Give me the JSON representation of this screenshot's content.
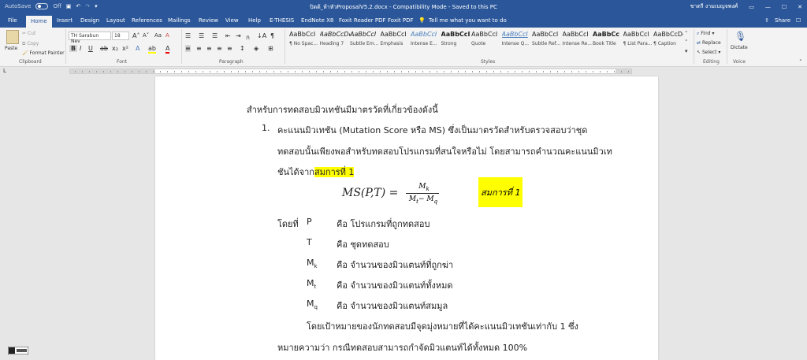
{
  "titlebar": {
    "autosave": "AutoSave",
    "autosave_state": "Off",
    "title": "ปิดต้_ห้าหัวProposalV5.2.docx  -  Compatibility Mode  -  Saved to this PC",
    "user": "ชาตรี งามเบญจพงศ์"
  },
  "tabs": [
    "File",
    "Home",
    "Insert",
    "Design",
    "Layout",
    "References",
    "Mailings",
    "Review",
    "View",
    "Help",
    "E-THESIS",
    "EndNote X8",
    "Foxit Reader PDF",
    "Foxit PDF"
  ],
  "tell_me": "Tell me what you want to do",
  "share": "Share",
  "clipboard": {
    "paste": "Paste",
    "cut": "Cut",
    "copy": "Copy",
    "format_painter": "Format Painter",
    "label": "Clipboard"
  },
  "font": {
    "name": "TH Sarabun Nev",
    "size": "18",
    "label": "Font"
  },
  "paragraph": {
    "label": "Paragraph"
  },
  "styles": {
    "label": "Styles",
    "items": [
      {
        "preview": "AaBbCcI",
        "name": "¶ No Spac..."
      },
      {
        "preview": "AaBbCcDc",
        "name": "Heading 7"
      },
      {
        "preview": "AaBbCcI",
        "name": "Subtle Em..."
      },
      {
        "preview": "AaBbCcI",
        "name": "Emphasis"
      },
      {
        "preview": "AaBbCcI",
        "name": "Intense E..."
      },
      {
        "preview": "AaBbCcI",
        "name": "Strong"
      },
      {
        "preview": "AaBbCcI",
        "name": "Quote"
      },
      {
        "preview": "AaBbCcI",
        "name": "Intense Q..."
      },
      {
        "preview": "AaBbCcI",
        "name": "Subtle Ref..."
      },
      {
        "preview": "AaBbCcI",
        "name": "Intense Re..."
      },
      {
        "preview": "AaBbCc",
        "name": "Book Title"
      },
      {
        "preview": "AaBbCcI",
        "name": "¶ List Para..."
      },
      {
        "preview": "AaBbCcDc",
        "name": "¶ Caption"
      }
    ]
  },
  "editing": {
    "find": "Find",
    "replace": "Replace",
    "select": "Select",
    "label": "Editing"
  },
  "voice": {
    "dictate": "Dictate",
    "label": "Voice"
  },
  "document": {
    "heading": "สำหรับการทดสอบมิวเทชันมีมาตรวัดที่เกี่ยวข้องดังนี้",
    "item_number": "1.",
    "item_line1": "คะแนนมิวเทชัน (Mutation Score หรือ MS) ซึ่งเป็นมาตรวัดสำหรับตรวจสอบว่าชุด",
    "item_line2": "ทดสอบนั้นเพียงพอสำหรับทดสอบโปรแกรมที่สนใจหรือไม่ โดยสามารถคำนวณคะแนนมิวเท",
    "item_line3_pre": "ชันได้จาก",
    "item_line3_hl": "สมการที่ 1",
    "equation": {
      "lhs": "MS(P,T)  =",
      "num": "M",
      "num_sub": "k",
      "den": "M",
      "den_sub1": "t",
      "den_mid": "− M",
      "den_sub2": "q",
      "tag": "สมการที่ 1"
    },
    "where": "โดยที่",
    "defs": [
      {
        "sym": "P",
        "sub": "",
        "desc": "คือ โปรแกรมที่ถูกทดสอบ"
      },
      {
        "sym": "T",
        "sub": "",
        "desc": "คือ ชุดทดสอบ"
      },
      {
        "sym": "M",
        "sub": "k",
        "desc": "คือ จำนวนของมิวแตนท์ที่ถูกฆ่า"
      },
      {
        "sym": "M",
        "sub": "t",
        "desc": "คือ จำนวนของมิวแตนท์ทั้งหมด"
      },
      {
        "sym": "M",
        "sub": "q",
        "desc": "คือ จำนวนของมิวแตนท์สมมูล"
      }
    ],
    "para_line1": "โดยเป้าหมายของนักทดสอบมีจุดมุ่งหมายที่ได้คะแนนมิวเทชันเท่ากับ 1 ซึ่ง",
    "para_line2": "หมายความว่า กรณีทดสอบสามารถกำจัดมิวแตนท์ได้ทั้งหมด 100%"
  }
}
